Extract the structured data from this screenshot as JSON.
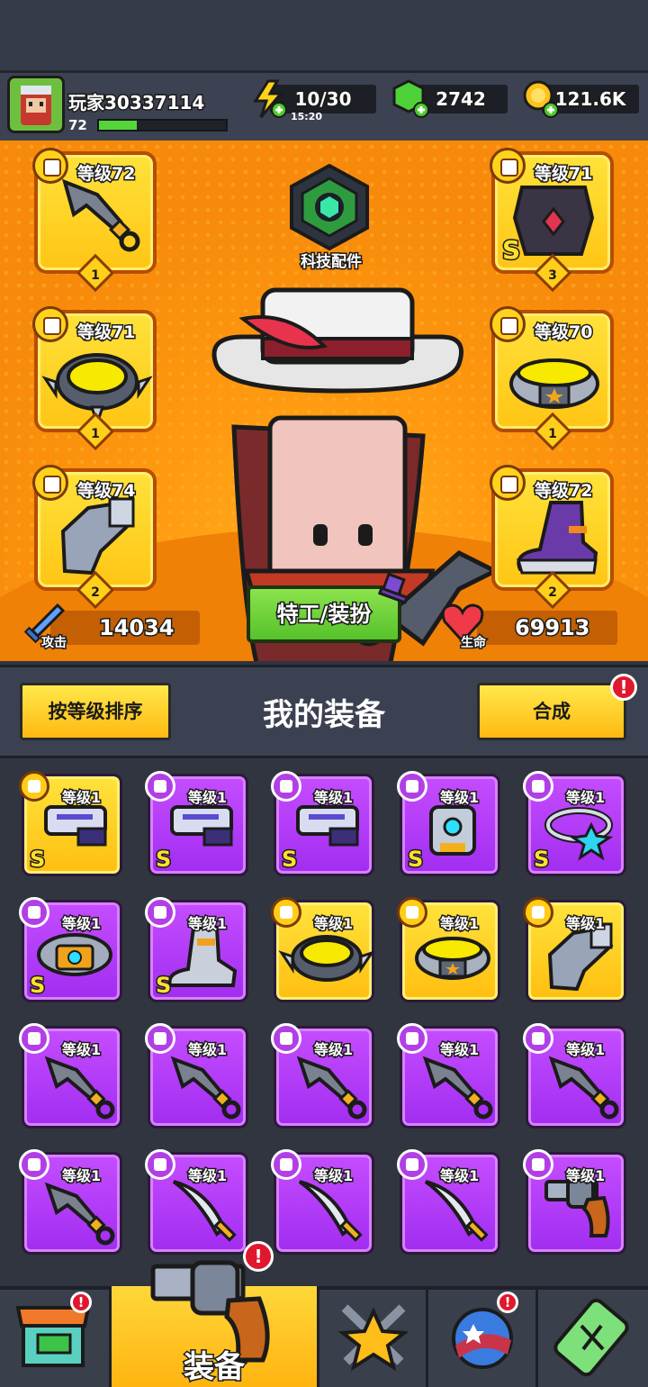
{
  "player": {
    "name": "玩家30337114",
    "level": "72",
    "xp_progress": 0.3
  },
  "resources": {
    "energy": {
      "value": "10/30",
      "timer": "15:20",
      "icon": "lightning-icon"
    },
    "gems": {
      "value": "2742",
      "icon": "green-gem-icon"
    },
    "gold": {
      "value": "121.6K",
      "icon": "gold-coin-icon"
    }
  },
  "equipped": {
    "weapon": {
      "level": "等级72",
      "count": "1",
      "icon": "kunai-icon"
    },
    "armor": {
      "level": "等级71",
      "count": "3",
      "rarity": "S",
      "icon": "dark-armor-icon"
    },
    "necklace": {
      "level": "等级71",
      "count": "1",
      "icon": "spiked-collar-icon"
    },
    "belt": {
      "level": "等级70",
      "count": "1",
      "icon": "star-belt-icon"
    },
    "gloves": {
      "level": "等级74",
      "count": "2",
      "icon": "gauntlet-icon"
    },
    "boots": {
      "level": "等级72",
      "count": "2",
      "icon": "purple-boots-icon"
    }
  },
  "tech": {
    "label": "科技配件",
    "icon": "tech-hexagon-icon"
  },
  "stats": {
    "attack_label": "攻击",
    "attack": "14034",
    "hp_label": "生命",
    "hp": "69913"
  },
  "agent_button": "特工/装扮",
  "section": {
    "sort_label": "按等级排序",
    "title": "我的装备",
    "merge_label": "合成",
    "merge_alert": "!"
  },
  "inventory": [
    {
      "level": "等级1",
      "rarity": "S",
      "color": "yellow",
      "icon": "blaster-gun-icon"
    },
    {
      "level": "等级1",
      "rarity": "S",
      "color": "purple",
      "icon": "blaster-gun-icon"
    },
    {
      "level": "等级1",
      "rarity": "S",
      "color": "purple",
      "icon": "blaster-gun-icon"
    },
    {
      "level": "等级1",
      "rarity": "S",
      "color": "purple",
      "icon": "mech-armor-icon"
    },
    {
      "level": "等级1",
      "rarity": "S",
      "color": "purple",
      "icon": "star-necklace-icon"
    },
    {
      "level": "等级1",
      "rarity": "S",
      "color": "purple",
      "icon": "tech-belt-icon"
    },
    {
      "level": "等级1",
      "rarity": "S",
      "color": "purple",
      "icon": "tech-boots-icon"
    },
    {
      "level": "等级1",
      "rarity": "",
      "color": "yellow",
      "icon": "spiked-collar-icon"
    },
    {
      "level": "等级1",
      "rarity": "",
      "color": "yellow",
      "icon": "star-belt-icon"
    },
    {
      "level": "等级1",
      "rarity": "",
      "color": "yellow",
      "icon": "gauntlet-icon"
    },
    {
      "level": "等级1",
      "rarity": "",
      "color": "purple",
      "icon": "kunai-icon"
    },
    {
      "level": "等级1",
      "rarity": "",
      "color": "purple",
      "icon": "kunai-icon"
    },
    {
      "level": "等级1",
      "rarity": "",
      "color": "purple",
      "icon": "kunai-icon"
    },
    {
      "level": "等级1",
      "rarity": "",
      "color": "purple",
      "icon": "kunai-icon"
    },
    {
      "level": "等级1",
      "rarity": "",
      "color": "purple",
      "icon": "kunai-icon"
    },
    {
      "level": "等级1",
      "rarity": "",
      "color": "purple",
      "icon": "kunai-icon"
    },
    {
      "level": "等级1",
      "rarity": "",
      "color": "purple",
      "icon": "sword-icon"
    },
    {
      "level": "等级1",
      "rarity": "",
      "color": "purple",
      "icon": "sword-icon"
    },
    {
      "level": "等级1",
      "rarity": "",
      "color": "purple",
      "icon": "sword-icon"
    },
    {
      "level": "等级1",
      "rarity": "",
      "color": "purple",
      "icon": "revolver-icon"
    }
  ],
  "nav": {
    "equip_label": "装备",
    "alert": "!",
    "tabs": [
      "shop-icon",
      "revolver-icon",
      "crossed-swords-star-icon",
      "planet-icon",
      "energy-capsule-icon"
    ]
  }
}
